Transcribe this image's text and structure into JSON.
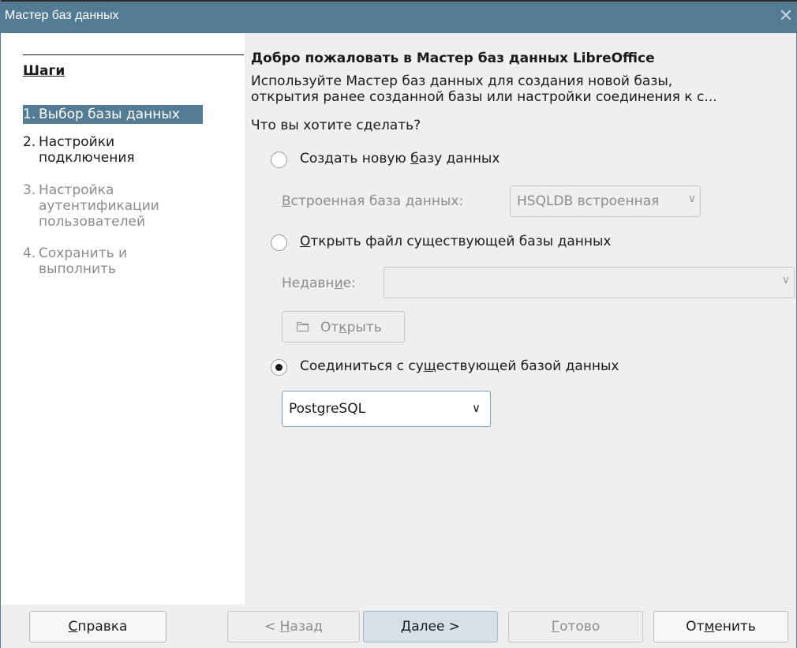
{
  "window": {
    "title": "Мастер баз данных",
    "close_icon": "close-icon"
  },
  "sidebar": {
    "title": "Шаги",
    "steps": [
      {
        "num": "1.",
        "label": "Выбор базы данных",
        "state": "active"
      },
      {
        "num": "2.",
        "label": "Настройки\nподключения",
        "state": "enabled"
      },
      {
        "num": "3.",
        "label": "Настройка\nаутентификации\nпользователей",
        "state": "disabled"
      },
      {
        "num": "4.",
        "label": "Сохранить и\nвыполнить",
        "state": "disabled"
      }
    ]
  },
  "main": {
    "heading": "Добро пожаловать в Мастер баз данных LibreOffice",
    "description_line1": "Используйте Мастер баз данных для создания новой базы,",
    "description_line2": "открытия ранее созданной базы или настройки соединения к с...",
    "question": "Что вы хотите сделать?",
    "option_create": {
      "pre": "Создать новую ",
      "accel": "б",
      "post": "азу данных",
      "checked": false
    },
    "embedded": {
      "label_accel": "В",
      "label_rest": "строенная база данных:",
      "value": "HSQLDB встроенная"
    },
    "option_open": {
      "pre": "",
      "accel": "О",
      "post": "ткрыть файл существующей базы данных",
      "checked": false
    },
    "recent": {
      "pre": "Недавн",
      "accel": "и",
      "post": "е:",
      "value": ""
    },
    "open_button": {
      "pre": "От",
      "accel": "к",
      "post": "рыть",
      "icon": "folder-icon"
    },
    "option_connect": {
      "pre": "Соединиться с су",
      "accel": "щ",
      "post": "ествующей базой данных",
      "checked": true
    },
    "connection_type": "PostgreSQL"
  },
  "buttons": {
    "help": {
      "accel": "С",
      "rest": "правка"
    },
    "back": {
      "pre": "< ",
      "accel": "Н",
      "post": "азад"
    },
    "next": {
      "accel": "Д",
      "post": "алее >"
    },
    "finish": {
      "accel": "Г",
      "post": "отово"
    },
    "cancel": {
      "pre": "От",
      "accel": "м",
      "post": "енить"
    }
  },
  "colors": {
    "titlebar": "#537b94",
    "selection": "#537b94",
    "dialog_bg": "#efefef",
    "disabled_text": "#8c8c8c"
  }
}
